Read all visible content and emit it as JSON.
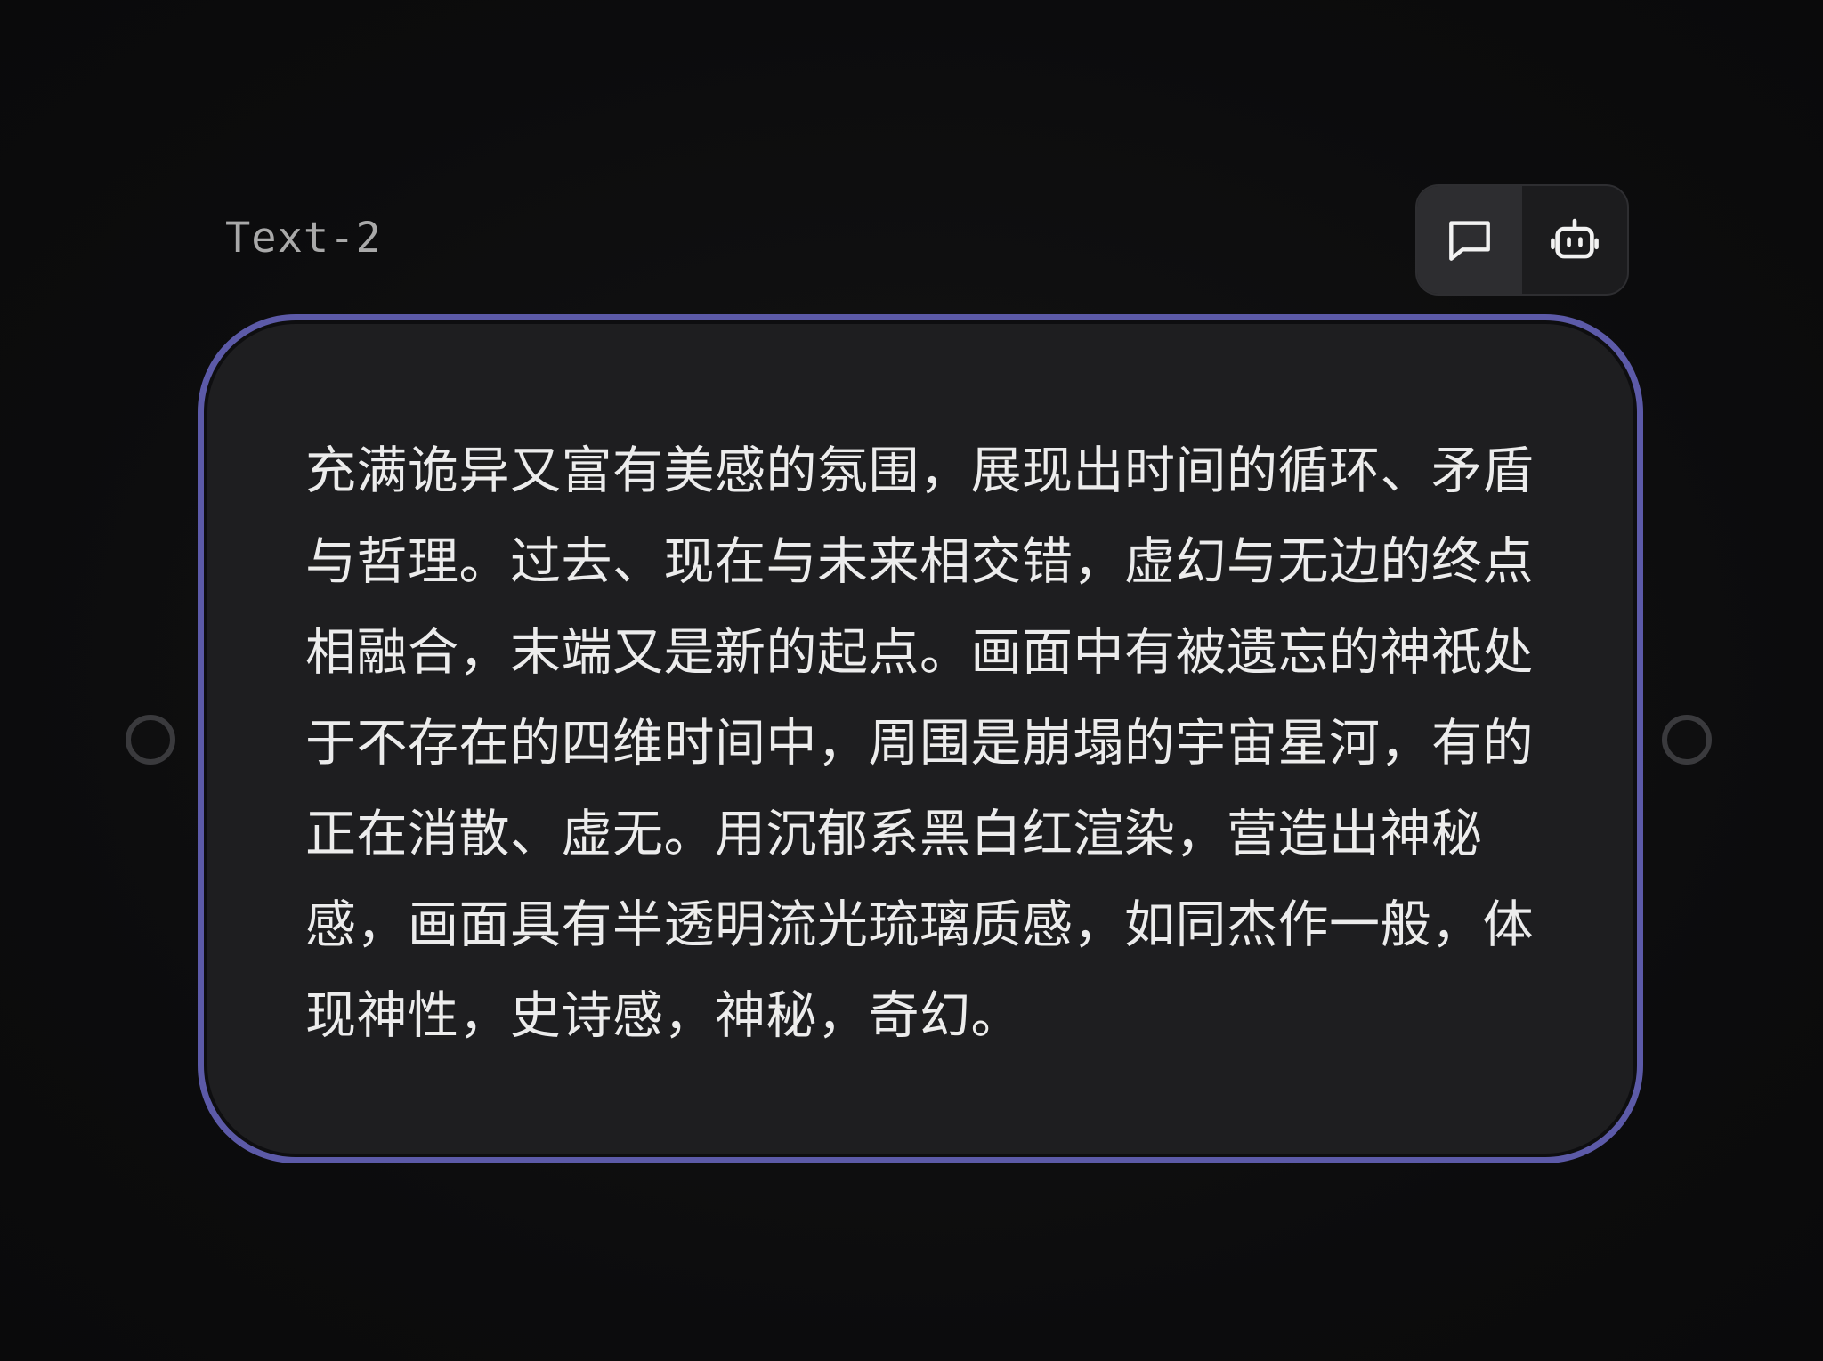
{
  "node": {
    "title": "Text-2",
    "text": "充满诡异又富有美感的氛围，展现出时间的循环、矛盾与哲理。过去、现在与未来相交错，虚幻与无边的终点相融合，末端又是新的起点。画面中有被遗忘的神祇处于不存在的四维时间中，周围是崩塌的宇宙星河，有的正在消散、虚无。用沉郁系黑白红渲染，营造出神秘感，画面具有半透明流光琉璃质感，如同杰作一般，体现神性，史诗感，神秘，奇幻。"
  },
  "toolbar": {
    "buttons": [
      {
        "icon": "chat-bubble-icon",
        "active": true
      },
      {
        "icon": "robot-icon",
        "active": false
      }
    ]
  },
  "colors": {
    "background": "#0d0d0e",
    "card": "#1e1e20",
    "card_border": "#5c5aa8",
    "text": "#ececec",
    "title": "#a9a9a9",
    "handle": "#3a3a3d"
  }
}
